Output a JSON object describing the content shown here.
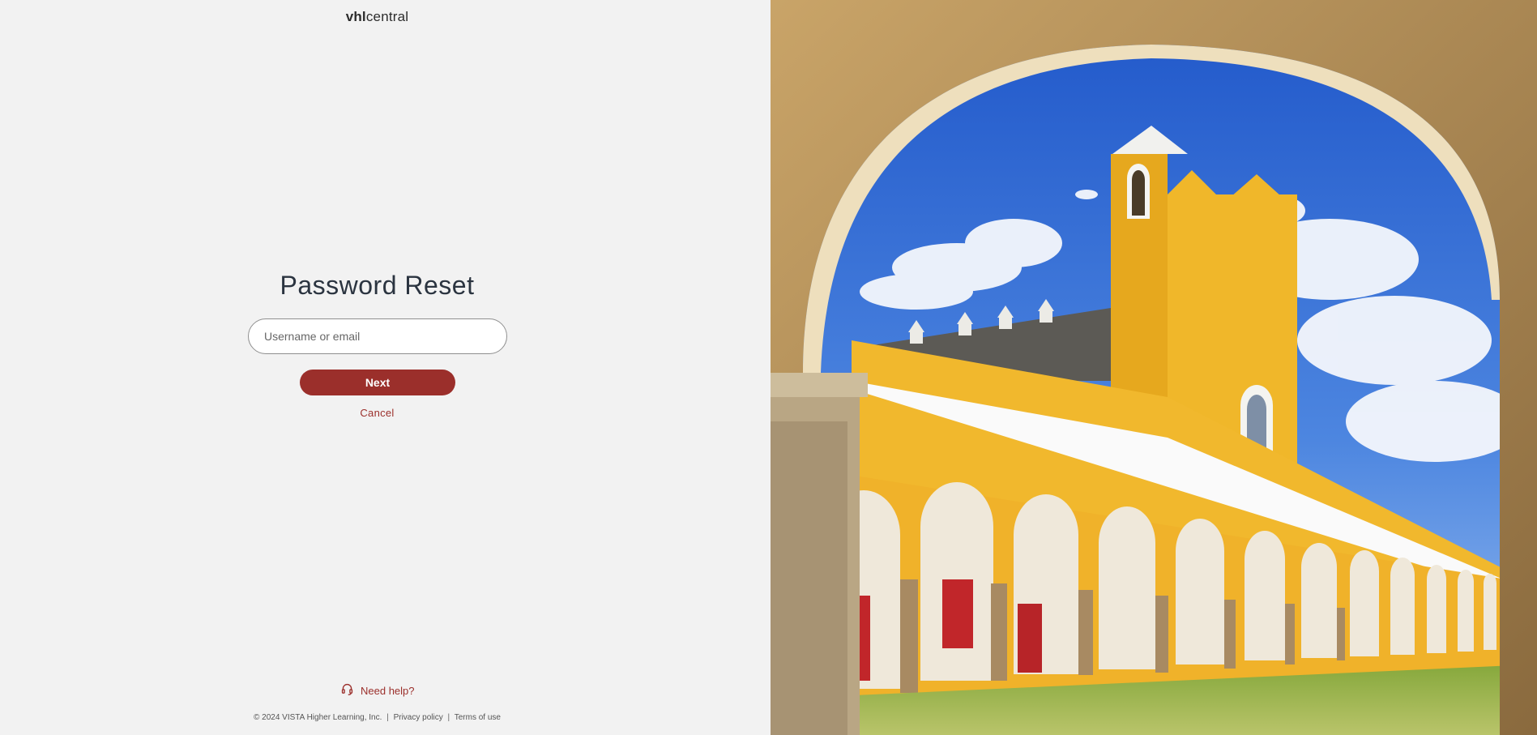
{
  "brand": {
    "bold": "vhl",
    "regular": "central"
  },
  "form": {
    "title": "Password Reset",
    "username_placeholder": "Username or email",
    "next_label": "Next",
    "cancel_label": "Cancel"
  },
  "help": {
    "label": "Need help?",
    "icon": "headset-icon"
  },
  "footer": {
    "copyright": "© 2024 VISTA Higher Learning, Inc.",
    "privacy": "Privacy policy",
    "terms": "Terms of use",
    "separator": "|"
  },
  "colors": {
    "accent": "#9b2f2b",
    "background": "#f2f2f2",
    "title": "#2b3440"
  }
}
